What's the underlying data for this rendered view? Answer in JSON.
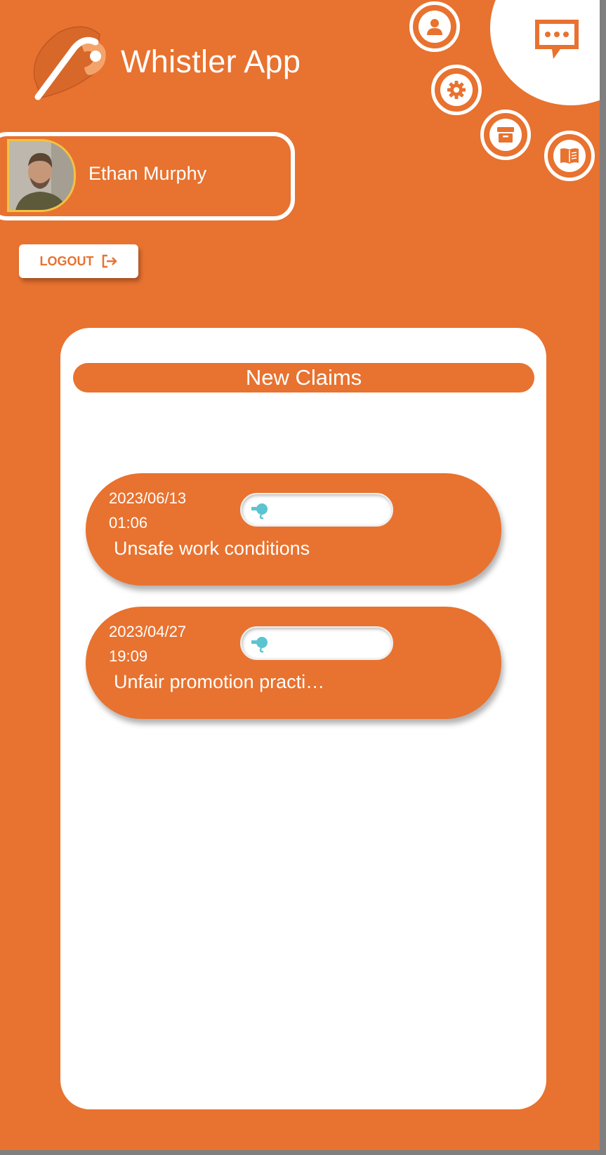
{
  "app": {
    "title": "Whistler App",
    "accent_color": "#e8722f",
    "highlight_color": "#f3c242"
  },
  "header_icons": [
    {
      "name": "profile-icon"
    },
    {
      "name": "settings-icon"
    },
    {
      "name": "archive-icon"
    },
    {
      "name": "book-icon"
    },
    {
      "name": "chat-icon"
    }
  ],
  "user": {
    "name": "Ethan Murphy"
  },
  "logout": {
    "label": "LOGOUT",
    "icon": "logout-icon"
  },
  "claims_section": {
    "header": "New Claims",
    "claims": [
      {
        "date": "2023/06/13",
        "time": "01:06",
        "title": "Unsafe work conditions",
        "status_icon": "whistle-icon",
        "status_color": "#5bc4d1"
      },
      {
        "date": "2023/04/27",
        "time": "19:09",
        "title": "Unfair promotion practi…",
        "status_icon": "whistle-icon",
        "status_color": "#5bc4d1"
      }
    ]
  }
}
